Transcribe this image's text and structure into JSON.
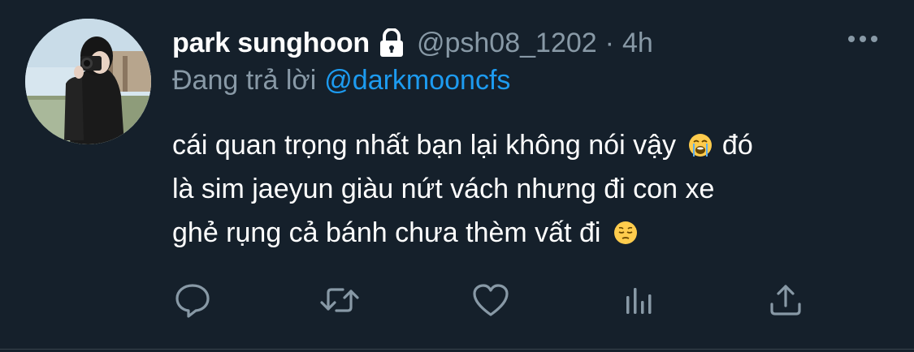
{
  "tweet": {
    "display_name": "park sunghoon",
    "protected_icon": "lock-icon",
    "handle": "@psh08_1202",
    "separator": "·",
    "timestamp": "4h",
    "more_icon": "more-horizontal-icon",
    "reply_prefix": "Đang trả lời",
    "reply_mention": "@darkmooncfs",
    "body_lines": [
      "cái quan trọng nhất bạn lại không nói vậy",
      "đó",
      "là sim jaeyun giàu nứt vách nhưng đi con xe",
      "ghẻ rụng cả bánh chưa thèm vất đi"
    ],
    "emoji": [
      "loudly-crying-face-emoji",
      "pensive-face-emoji"
    ]
  },
  "actions": [
    {
      "name": "reply",
      "icon": "reply-icon"
    },
    {
      "name": "retweet",
      "icon": "retweet-icon"
    },
    {
      "name": "like",
      "icon": "heart-icon"
    },
    {
      "name": "analytics",
      "icon": "analytics-icon"
    },
    {
      "name": "share",
      "icon": "share-icon"
    }
  ],
  "colors": {
    "background": "#15202b",
    "primary_text": "#ffffff",
    "secondary_text": "#8899a6",
    "link": "#1d9bf0",
    "icon": "#8899a6"
  }
}
